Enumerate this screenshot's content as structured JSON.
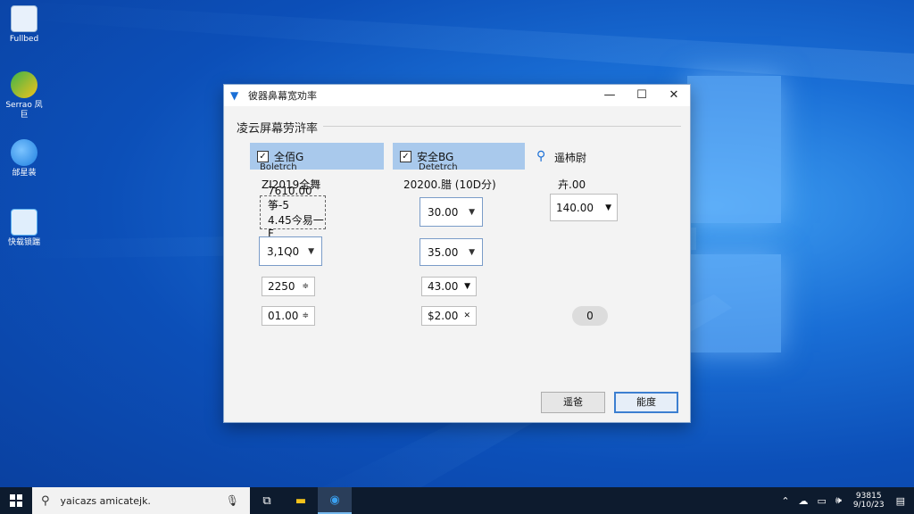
{
  "desktop": {
    "icons": [
      {
        "label": "Fullbed",
        "color": "#6aa8e8"
      },
      {
        "label": "Serrao 凤 巨",
        "color": "#3cb44a"
      },
      {
        "label": "邰星装",
        "color": "#1e7fe0"
      },
      {
        "label": "快载锁踹",
        "color": "#5ab0f0"
      }
    ]
  },
  "dialog": {
    "title": "彼器鼻幕宽劝率",
    "group_title": "凌云屏幕劳浒率",
    "columns": [
      {
        "header": "全佰G",
        "sub": "Boletrch",
        "checked": true
      },
      {
        "header": "安全BG",
        "sub": "Detetrch",
        "checked": true
      },
      {
        "header": "遥柿尉"
      }
    ],
    "col1": {
      "row1": "ZI2019全舞",
      "dashed_line1": "7610.00筝-5",
      "dashed_line2": "4.45今易一F",
      "field": "3,1Q0",
      "row4": "2250",
      "row5": "01.00"
    },
    "col2": {
      "row1": "20200.腊 (10D分)",
      "field1": "30.00",
      "field2": "35.00",
      "row4": "43.00",
      "row5": "$2.00"
    },
    "col3": {
      "row1": "卉.00",
      "field": "140.00",
      "pill": "0"
    },
    "buttons": {
      "cancel": "遥爸",
      "ok": "能度"
    }
  },
  "taskbar": {
    "search_text": "yaicazs amicatejk.",
    "clock_time": "93815",
    "clock_date": "9/10/23"
  }
}
